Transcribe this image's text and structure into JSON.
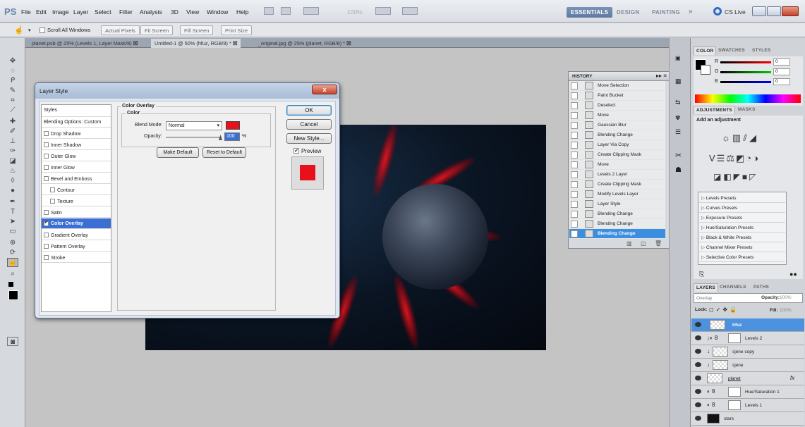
{
  "app": {
    "logo": "PS"
  },
  "menu": [
    "File",
    "Edit",
    "Image",
    "Layer",
    "Select",
    "Filter",
    "Analysis",
    "3D",
    "View",
    "Window",
    "Help"
  ],
  "menubar_extra": {
    "zoom": "100%"
  },
  "workspaces": {
    "essentials": "ESSENTIALS",
    "design": "DESIGN",
    "painting": "PAINTING",
    "more": "»",
    "cslive": "CS Live"
  },
  "options": {
    "scroll_all": "Scroll All Windows",
    "actual_pixels": "Actual Pixels",
    "fit_screen": "Fit Screen",
    "fill_screen": "Fill Screen",
    "print_size": "Print Size"
  },
  "doc_tabs": [
    "planet.psb @ 25% (Levels 1, Layer Mask/8)",
    "Untitled-1 @ 50% (hfuz, RGB/8) *",
    "_original.jpg @ 25% (planet, RGB/8) *"
  ],
  "dialog": {
    "title": "Layer Style",
    "close": "x",
    "styles_header": "Styles",
    "blending_options": "Blending Options: Custom",
    "styles": [
      {
        "label": "Drop Shadow",
        "checked": false
      },
      {
        "label": "Inner Shadow",
        "checked": false
      },
      {
        "label": "Outer Glow",
        "checked": false
      },
      {
        "label": "Inner Glow",
        "checked": false
      },
      {
        "label": "Bevel and Emboss",
        "checked": false
      },
      {
        "label": "Contour",
        "checked": false
      },
      {
        "label": "Texture",
        "checked": false
      },
      {
        "label": "Satin",
        "checked": false
      },
      {
        "label": "Color Overlay",
        "checked": true,
        "selected": true
      },
      {
        "label": "Gradient Overlay",
        "checked": false
      },
      {
        "label": "Pattern Overlay",
        "checked": false
      },
      {
        "label": "Stroke",
        "checked": false
      }
    ],
    "group_title": "Color Overlay",
    "sub_group_title": "Color",
    "blend_mode_label": "Blend Mode:",
    "blend_mode_value": "Normal",
    "overlay_color": "#e8101a",
    "opacity_label": "Opacity:",
    "opacity_value": "100",
    "opacity_unit": "%",
    "make_default": "Make Default",
    "reset_default": "Reset to Default",
    "ok": "OK",
    "cancel": "Cancel",
    "new_style": "New Style...",
    "preview_label": "Preview",
    "preview_checked": true,
    "preview_color": "#e8101a"
  },
  "history": {
    "title": "HISTORY",
    "items": [
      "Move Selection",
      "Paint Bucket",
      "Deselect",
      "Move",
      "Gaussian Blur",
      "Blending Change",
      "Layer Via Copy",
      "Create Clipping Mask",
      "Move",
      "Levels 2 Layer",
      "Create Clipping Mask",
      "Modify Levels Layer",
      "Layer Style",
      "Blending Change",
      "Blending Change",
      "Blending Change"
    ],
    "selected_index": 15
  },
  "color_panel": {
    "tabs": [
      "COLOR",
      "SWATCHES",
      "STYLES"
    ],
    "r_label": "R",
    "r_value": "0",
    "g_label": "G",
    "g_value": "0",
    "b_label": "B",
    "b_value": "0"
  },
  "adjustments": {
    "tabs": [
      "ADJUSTMENTS",
      "MASKS"
    ],
    "heading": "Add an adjustment",
    "presets": [
      "Levels Presets",
      "Curves Presets",
      "Exposure Presets",
      "Hue/Saturation Presets",
      "Black & White Presets",
      "Channel Mixer Presets",
      "Selective Color Presets"
    ]
  },
  "layers_panel": {
    "tabs": [
      "LAYERS",
      "CHANNELS",
      "PATHS"
    ],
    "blend_mode": "Overlay",
    "opacity_label": "Opacity:",
    "opacity_value": "100%",
    "lock_label": "Lock:",
    "fill_label": "Fill:",
    "fill_value": "100%",
    "layers": [
      {
        "name": "hfuz",
        "selected": true
      },
      {
        "name": "Levels 2",
        "selected": false
      },
      {
        "name": "sjene copy",
        "selected": false
      },
      {
        "name": "sjene",
        "selected": false
      },
      {
        "name": "planet",
        "selected": false,
        "fx": "fx"
      },
      {
        "name": "Hue/Saturation 1",
        "selected": false
      },
      {
        "name": "Levels 1",
        "selected": false
      },
      {
        "name": "stars",
        "selected": false
      }
    ]
  }
}
